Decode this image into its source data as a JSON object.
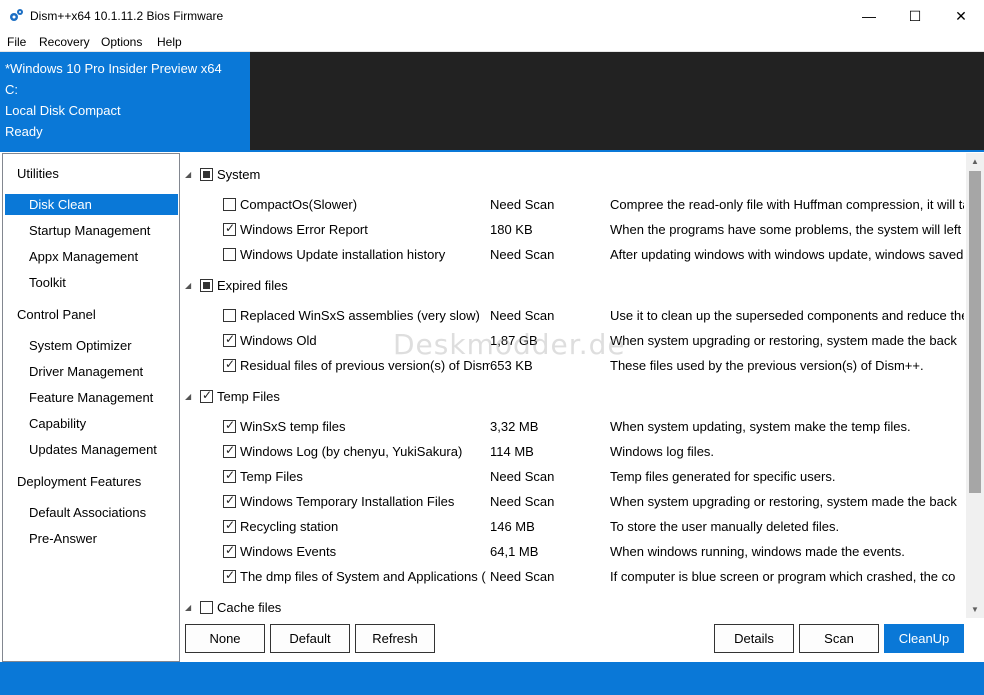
{
  "window": {
    "title": "Dism++x64 10.1.11.2 Bios Firmware",
    "minimize_glyph": "—",
    "maximize_glyph": "☐",
    "close_glyph": "✕"
  },
  "menu": [
    "File",
    "Recovery",
    "Options",
    "Help"
  ],
  "info": {
    "os": "*Windows 10 Pro Insider Preview x64",
    "drive": "C:",
    "disk": "Local Disk Compact",
    "status": "Ready"
  },
  "sidebar": {
    "sections": [
      {
        "label": "Utilities",
        "items": [
          "Disk Clean",
          "Startup Management",
          "Appx Management",
          "Toolkit"
        ]
      },
      {
        "label": "Control Panel",
        "items": [
          "System Optimizer",
          "Driver Management",
          "Feature Management",
          "Capability",
          "Updates Management"
        ]
      },
      {
        "label": "Deployment Features",
        "items": [
          "Default Associations",
          "Pre-Answer"
        ]
      }
    ],
    "selected": "Disk Clean"
  },
  "groups": [
    {
      "label": "System",
      "state": "partial",
      "items": [
        {
          "name": "CompactOs(Slower)",
          "size": "Need Scan",
          "desc": "Compree the read-only file with Huffman compression, it will take",
          "checked": false
        },
        {
          "name": "Windows Error Report",
          "size": "180 KB",
          "desc": "When the programs have some problems, the system will left",
          "checked": true
        },
        {
          "name": "Windows Update installation history",
          "size": "Need Scan",
          "desc": "After updating windows with windows update, windows saved",
          "checked": false
        }
      ]
    },
    {
      "label": "Expired files",
      "state": "partial",
      "items": [
        {
          "name": "Replaced WinSxS assemblies (very slow)",
          "size": "Need Scan",
          "desc": "Use it to clean up the superseded components and reduce the",
          "checked": false
        },
        {
          "name": "Windows Old",
          "size": "1,87 GB",
          "desc": "When system upgrading or restoring, system made the back",
          "checked": true
        },
        {
          "name": "Residual files of previous version(s) of Dism++",
          "size": "653 KB",
          "desc": "These files used by the previous version(s) of Dism++.",
          "checked": true
        }
      ]
    },
    {
      "label": "Temp Files",
      "state": "checked",
      "items": [
        {
          "name": "WinSxS temp files",
          "size": "3,32 MB",
          "desc": "When system updating, system make the temp files.",
          "checked": true
        },
        {
          "name": "Windows Log (by chenyu, YukiSakura)",
          "size": "114 MB",
          "desc": "Windows log files.",
          "checked": true
        },
        {
          "name": "Temp Files",
          "size": "Need Scan",
          "desc": "Temp files generated for specific users.",
          "checked": true
        },
        {
          "name": "Windows Temporary Installation Files",
          "size": "Need Scan",
          "desc": "When system upgrading or restoring, system made the back",
          "checked": true
        },
        {
          "name": "Recycling station",
          "size": "146 MB",
          "desc": "To store the user manually deleted files.",
          "checked": true
        },
        {
          "name": "Windows Events",
          "size": "64,1 MB",
          "desc": "When windows running, windows made the events.",
          "checked": true
        },
        {
          "name": "The dmp files of System and Applications (",
          "size": "Need Scan",
          "desc": "If computer is blue screen or program which crashed, the co",
          "checked": true
        }
      ]
    },
    {
      "label": "Cache files",
      "state": "unchecked",
      "items": []
    }
  ],
  "watermark": "Deskmodder.de",
  "buttons": {
    "none": "None",
    "default": "Default",
    "refresh": "Refresh",
    "details": "Details",
    "scan": "Scan",
    "cleanup": "CleanUp"
  },
  "colors": {
    "accent": "#0a78d7",
    "dark_panel": "#222222"
  }
}
